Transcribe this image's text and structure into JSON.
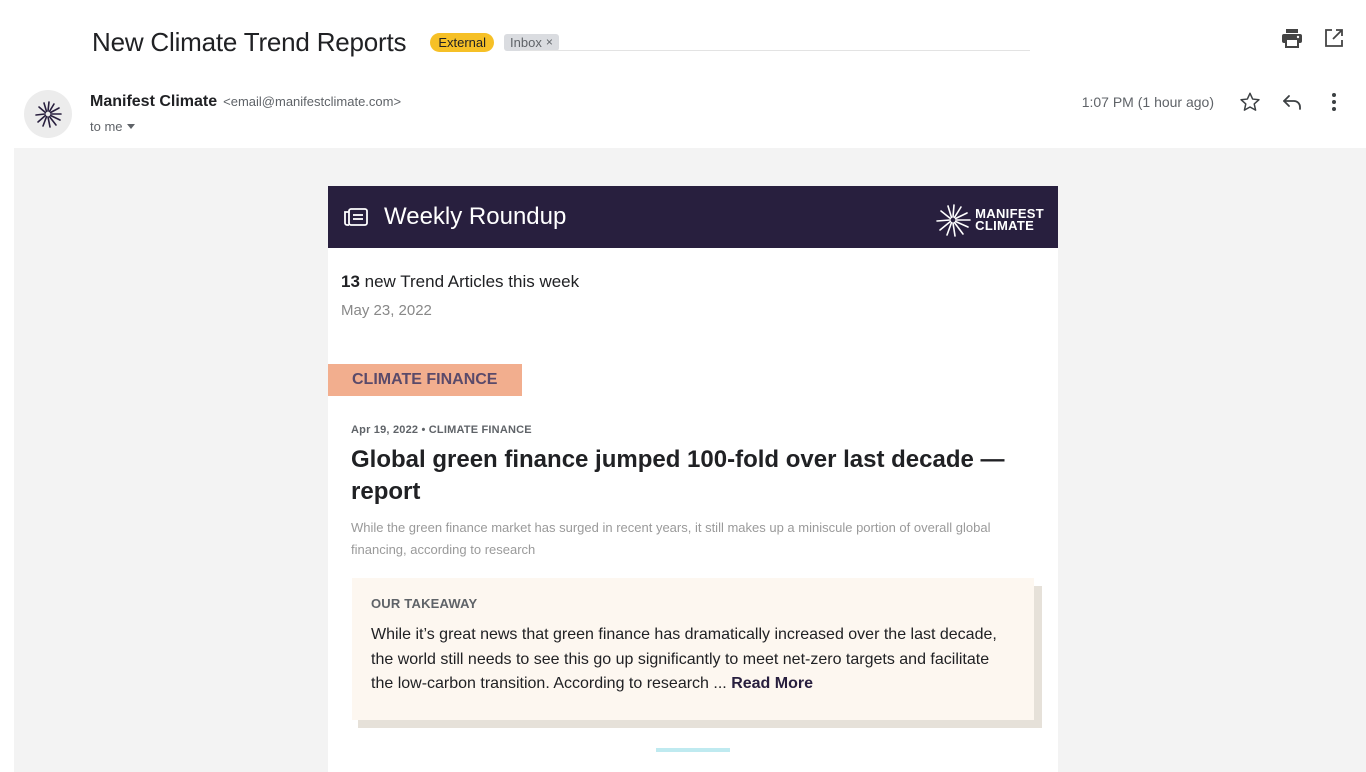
{
  "email": {
    "subject": "New Climate Trend Reports",
    "labels": {
      "external": "External",
      "inbox": "Inbox",
      "inbox_remove": "×"
    },
    "sender": {
      "name": "Manifest Climate",
      "email": "<email@manifestclimate.com>"
    },
    "recipient": "to me",
    "timestamp": "1:07 PM (1 hour ago)"
  },
  "icons": {
    "top": [
      "print-icon",
      "open-in-new-window-icon"
    ],
    "meta": [
      "star-icon",
      "reply-icon",
      "more-vert-icon"
    ]
  },
  "newsletter": {
    "header_title": "Weekly Roundup",
    "logo_line1": "MANIFEST",
    "logo_line2": "CLIMATE",
    "count": "13",
    "count_text": " new Trend Articles this week",
    "date": "May 23, 2022",
    "category": "CLIMATE FINANCE",
    "article": {
      "meta": "Apr 19, 2022  •  CLIMATE FINANCE",
      "title": "Global green finance jumped 100-fold over last decade — report",
      "summary": "While the green finance market has surged in recent years, it still makes up a miniscule portion of overall global financing, according to research"
    },
    "takeaway": {
      "label": "OUR TAKEAWAY",
      "text": "While it’s great news that green finance has dramatically increased over the last decade, the world still needs to see this go up significantly to meet net-zero targets and facilitate the low-carbon transition. According to research ... ",
      "read_more": "Read More"
    }
  },
  "colors": {
    "header_bg": "#281f3e",
    "external_badge": "#f6c026",
    "category_tag": "#f2ae8e",
    "takeaway_bg": "#fdf7f0",
    "accent_divider": "#bfeaf0"
  }
}
